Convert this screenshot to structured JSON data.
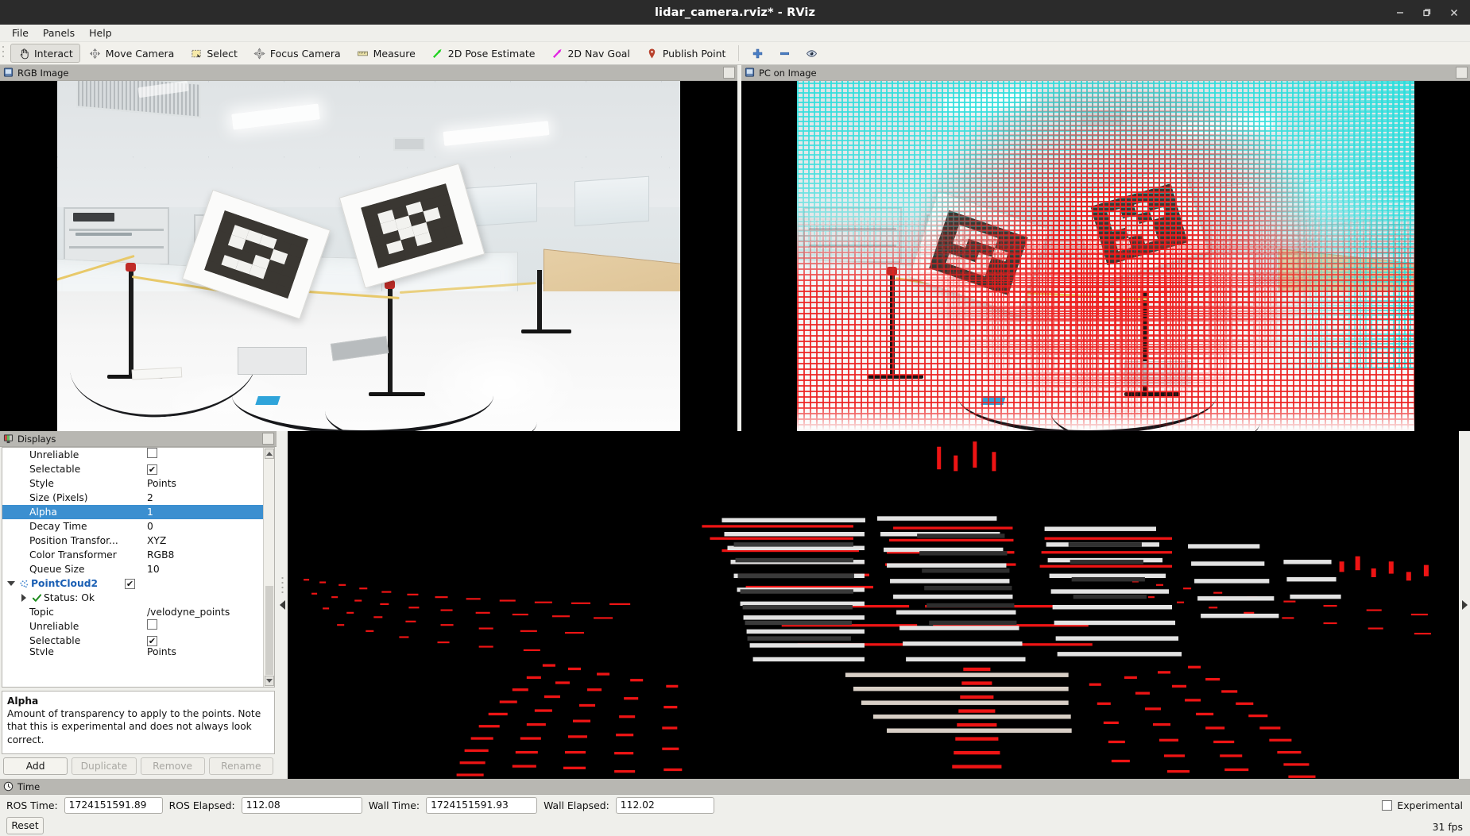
{
  "window": {
    "title": "lidar_camera.rviz* - RViz",
    "minimize_label": "—",
    "maximize_label": "❐",
    "close_label": "✕"
  },
  "menu": {
    "items": [
      {
        "label": "File"
      },
      {
        "label": "Panels"
      },
      {
        "label": "Help"
      }
    ]
  },
  "toolbar": {
    "buttons": [
      {
        "label": "Interact",
        "icon": "hand-cursor-icon",
        "checked": true
      },
      {
        "label": "Move Camera",
        "icon": "move-camera-icon",
        "checked": false
      },
      {
        "label": "Select",
        "icon": "select-rectangle-icon",
        "checked": false
      },
      {
        "label": "Focus Camera",
        "icon": "focus-camera-icon",
        "checked": false
      },
      {
        "label": "Measure",
        "icon": "ruler-icon",
        "checked": false
      },
      {
        "label": "2D Pose Estimate",
        "icon": "green-arrow-icon",
        "checked": false
      },
      {
        "label": "2D Nav Goal",
        "icon": "magenta-arrow-icon",
        "checked": false
      },
      {
        "label": "Publish Point",
        "icon": "map-pin-icon",
        "checked": false
      }
    ],
    "tools": [
      {
        "icon": "plus-icon",
        "name": "add-tool"
      },
      {
        "icon": "minus-icon",
        "name": "remove-tool"
      },
      {
        "icon": "eye-icon",
        "name": "view-tool"
      }
    ]
  },
  "panels": {
    "rgb_image": {
      "title": "RGB Image",
      "icon": "image-panel-icon"
    },
    "pc_on_image": {
      "title": "PC on Image",
      "icon": "image-panel-icon"
    },
    "displays": {
      "title": "Displays",
      "icon": "displays-panel-icon"
    },
    "time": {
      "title": "Time",
      "icon": "clock-icon"
    }
  },
  "displays": {
    "rows": [
      {
        "label": "Unreliable",
        "value": "",
        "type": "checkbox",
        "checked": false,
        "depth": 2,
        "selected": false
      },
      {
        "label": "Selectable",
        "value": "",
        "type": "checkbox",
        "checked": true,
        "depth": 2,
        "selected": false
      },
      {
        "label": "Style",
        "value": "Points",
        "type": "text",
        "depth": 2,
        "selected": false
      },
      {
        "label": "Size (Pixels)",
        "value": "2",
        "type": "text",
        "depth": 2,
        "selected": false
      },
      {
        "label": "Alpha",
        "value": "1",
        "type": "text",
        "depth": 2,
        "selected": true
      },
      {
        "label": "Decay Time",
        "value": "0",
        "type": "text",
        "depth": 2,
        "selected": false
      },
      {
        "label": "Position Transfor...",
        "value": "XYZ",
        "type": "text",
        "depth": 2,
        "selected": false
      },
      {
        "label": "Color Transformer",
        "value": "RGB8",
        "type": "text",
        "depth": 2,
        "selected": false
      },
      {
        "label": "Queue Size",
        "value": "10",
        "type": "text",
        "depth": 2,
        "selected": false
      },
      {
        "label": "PointCloud2",
        "value": "",
        "type": "checkbox",
        "checked": true,
        "depth": 0,
        "selected": false,
        "bold": true,
        "expander": "down",
        "icon": "pointcloud-icon"
      },
      {
        "label": "Status: Ok",
        "value": "",
        "type": "status",
        "depth": 1,
        "selected": false,
        "expander": "right",
        "icon": "check-icon"
      },
      {
        "label": "Topic",
        "value": "/velodyne_points",
        "type": "text",
        "depth": 2,
        "selected": false
      },
      {
        "label": "Unreliable",
        "value": "",
        "type": "checkbox",
        "checked": false,
        "depth": 2,
        "selected": false
      },
      {
        "label": "Selectable",
        "value": "",
        "type": "checkbox",
        "checked": true,
        "depth": 2,
        "selected": false
      },
      {
        "label": "Style",
        "value": "Points",
        "type": "text",
        "depth": 2,
        "selected": false,
        "clipped": true
      }
    ],
    "description": {
      "title": "Alpha",
      "body": "Amount of transparency to apply to the points. Note that this is experimental and does not always look correct."
    },
    "buttons": [
      {
        "label": "Add",
        "enabled": true
      },
      {
        "label": "Duplicate",
        "enabled": false
      },
      {
        "label": "Remove",
        "enabled": false
      },
      {
        "label": "Rename",
        "enabled": false
      }
    ]
  },
  "time": {
    "ros_time_label": "ROS Time:",
    "ros_time_value": "1724151591.89",
    "ros_elapsed_label": "ROS Elapsed:",
    "ros_elapsed_value": "112.08",
    "wall_time_label": "Wall Time:",
    "wall_time_value": "1724151591.93",
    "wall_elapsed_label": "Wall Elapsed:",
    "wall_elapsed_value": "112.02",
    "reset_label": "Reset",
    "experimental_label": "Experimental",
    "experimental_checked": false,
    "fps": "31 fps"
  },
  "colors": {
    "titlebar_bg": "#2b2b2b",
    "chrome_bg": "#efefeb",
    "panel_header_bg": "#b8b7b2",
    "selection_blue": "#3b8fd0",
    "link_blue": "#1a5fb4",
    "pointcloud_red": "#ed1c1c",
    "pointcloud_cyan": "#2cdedc",
    "status_green": "#27a327",
    "viewport_bg": "#000000"
  }
}
